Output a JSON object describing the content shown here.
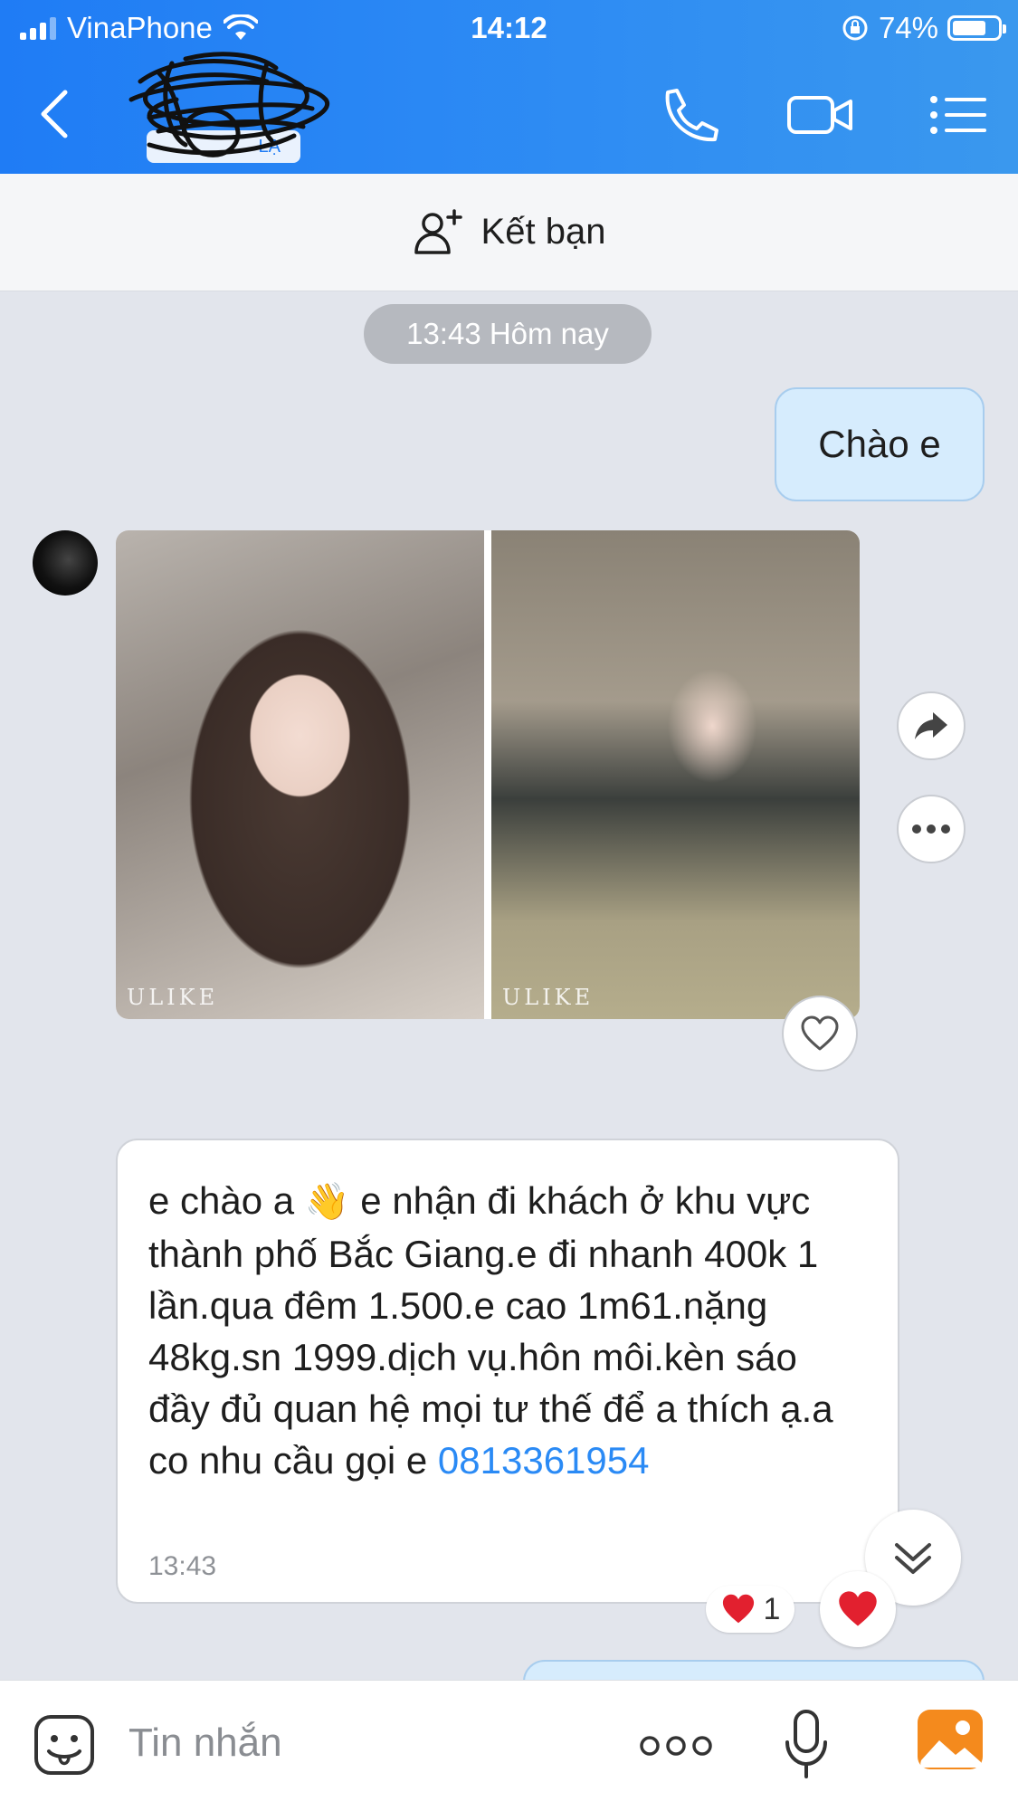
{
  "status_bar": {
    "carrier": "VinaPhone",
    "time": "14:12",
    "battery": "74%",
    "battery_level": 0.74
  },
  "header": {
    "contact_badge": "LẠ",
    "icons": [
      "back-icon",
      "phone-icon",
      "video-call-icon",
      "menu-icon"
    ]
  },
  "friend_bar": {
    "label": "Kết bạn",
    "icon": "add-friend-icon"
  },
  "chat": {
    "date_separator": "13:43 Hôm nay",
    "outgoing": [
      {
        "text": "Chào e"
      }
    ],
    "photo_message": {
      "watermarks": [
        "ULIKE",
        "ULIKE"
      ]
    },
    "incoming_text": {
      "text": "e chào a",
      "emoji": "👋",
      "text_after_emoji": " e nhận đi khách ở khu vực thành phố Bắc Giang.e đi nhanh 400k 1 lần.qua đêm 1.500.e cao 1m61.nặng 48kg.sn 1999.dịch vụ.hôn môi.kèn sáo đầy đủ quan hệ mọi tư thế để a thích ạ.a co nhu cầu gọi e ",
      "phone": "0813361954",
      "time": "13:43"
    },
    "reactions": {
      "emoji": "❤️",
      "count": "1"
    }
  },
  "input_bar": {
    "placeholder": "Tin nhắn",
    "more_label": "ooo"
  },
  "colors": {
    "header_blue": "#1f7cf5",
    "bubble_out": "#d6ecfd",
    "link": "#2a8af5",
    "heart": "#e2202f"
  }
}
